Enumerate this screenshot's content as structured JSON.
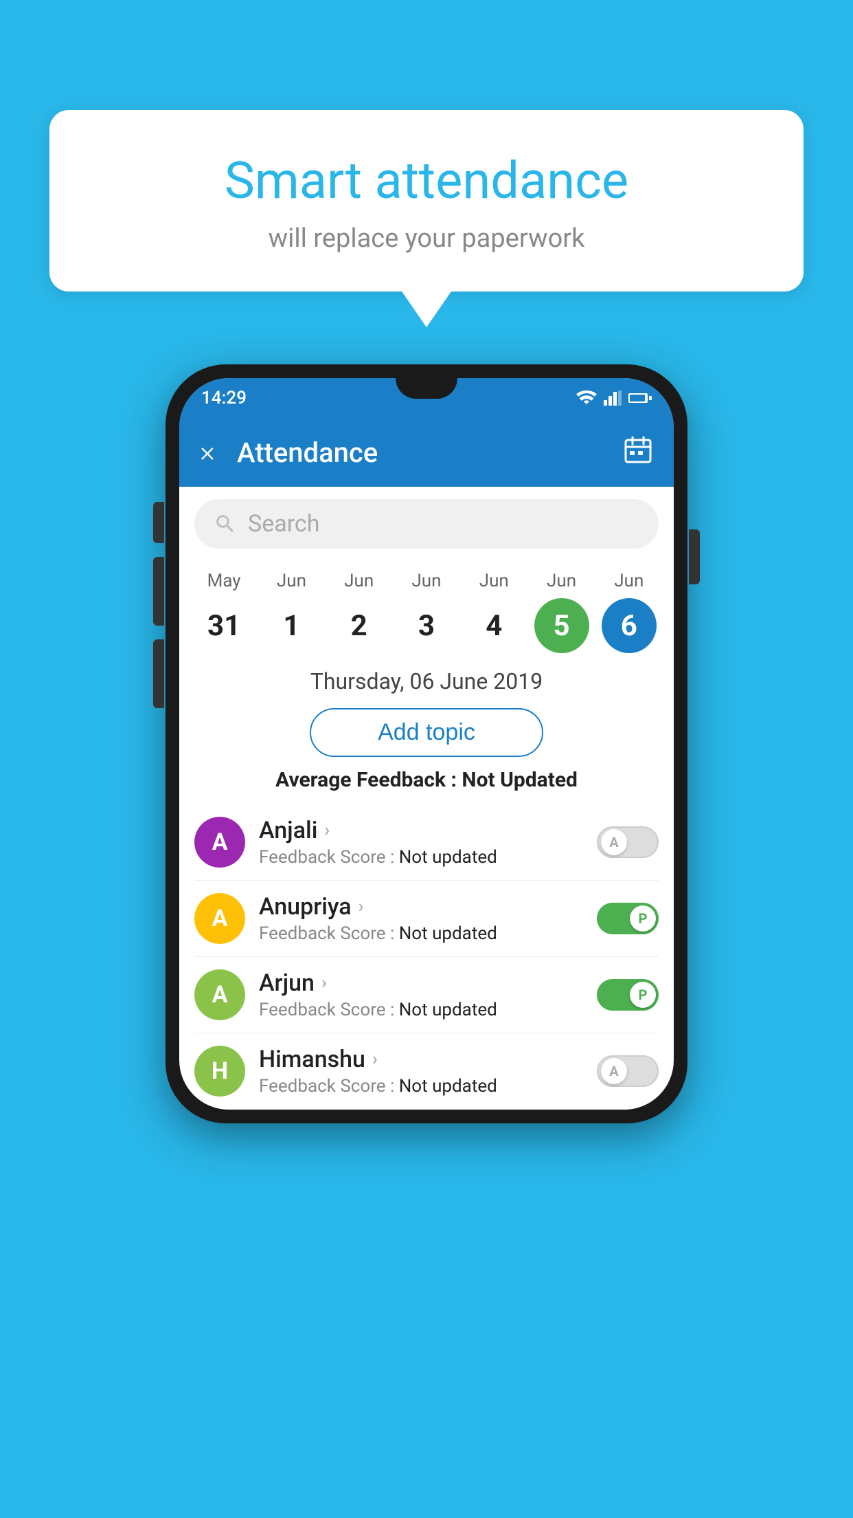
{
  "background_color": "#29b6e8",
  "speech_bubble": {
    "title": "Smart attendance",
    "subtitle": "will replace your paperwork"
  },
  "status_bar": {
    "time": "14:29"
  },
  "app_bar": {
    "title": "Attendance",
    "close_label": "×",
    "calendar_icon": "📅"
  },
  "search": {
    "placeholder": "Search"
  },
  "calendar": {
    "days": [
      {
        "month": "May",
        "day": "31",
        "style": "normal"
      },
      {
        "month": "Jun",
        "day": "1",
        "style": "normal"
      },
      {
        "month": "Jun",
        "day": "2",
        "style": "normal"
      },
      {
        "month": "Jun",
        "day": "3",
        "style": "normal"
      },
      {
        "month": "Jun",
        "day": "4",
        "style": "normal"
      },
      {
        "month": "Jun",
        "day": "5",
        "style": "green"
      },
      {
        "month": "Jun",
        "day": "6",
        "style": "blue"
      }
    ]
  },
  "selected_date": "Thursday, 06 June 2019",
  "add_topic_label": "Add topic",
  "avg_feedback_label": "Average Feedback :",
  "avg_feedback_value": "Not Updated",
  "students": [
    {
      "name": "Anjali",
      "initial": "A",
      "avatar_color": "#9c27b0",
      "feedback_label": "Feedback Score :",
      "feedback_value": "Not updated",
      "toggle_state": "off",
      "toggle_letter": "A"
    },
    {
      "name": "Anupriya",
      "initial": "A",
      "avatar_color": "#ffc107",
      "feedback_label": "Feedback Score :",
      "feedback_value": "Not updated",
      "toggle_state": "on",
      "toggle_letter": "P"
    },
    {
      "name": "Arjun",
      "initial": "A",
      "avatar_color": "#8bc34a",
      "feedback_label": "Feedback Score :",
      "feedback_value": "Not updated",
      "toggle_state": "on",
      "toggle_letter": "P"
    },
    {
      "name": "Himanshu",
      "initial": "H",
      "avatar_color": "#8bc34a",
      "feedback_label": "Feedback Score :",
      "feedback_value": "Not updated",
      "toggle_state": "off",
      "toggle_letter": "A"
    }
  ]
}
